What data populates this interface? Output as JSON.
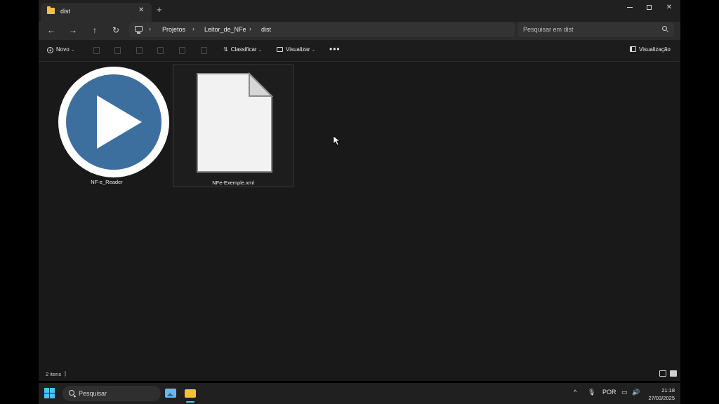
{
  "window": {
    "tab_title": "dist",
    "tab_close": "✕",
    "new_tab": "+",
    "close_glyph": "✕"
  },
  "nav": {
    "back": "←",
    "forward": "→",
    "up": "↑",
    "refresh": "↻"
  },
  "breadcrumb": {
    "separator": "›",
    "items": [
      "Projetos",
      "Leitor_de_NFe",
      "dist"
    ]
  },
  "search": {
    "placeholder": "Pesquisar em dist"
  },
  "toolbar": {
    "new_label": "Novo",
    "sort_label": "Classificar",
    "view_label": "Visualizar",
    "more": "•••",
    "preview_label": "Visualização",
    "chevron": "⌄"
  },
  "files": [
    {
      "name": "NF-e_Reader",
      "icon": "play-app-icon",
      "color": "#3d6f9e"
    },
    {
      "name": "NFe-Exemple.xml",
      "icon": "document-icon",
      "selected": true
    }
  ],
  "status": {
    "count": "2 itens",
    "separator": "|"
  },
  "taskbar": {
    "search_placeholder": "Pesquisar",
    "tray": {
      "chevron": "^",
      "language": "POR"
    },
    "clock": {
      "time": "21:18",
      "date": "27/03/2025"
    }
  },
  "colors": {
    "accent": "#4cc2ff",
    "folder": "#f0c33c",
    "app_icon": "#3d6f9e"
  }
}
